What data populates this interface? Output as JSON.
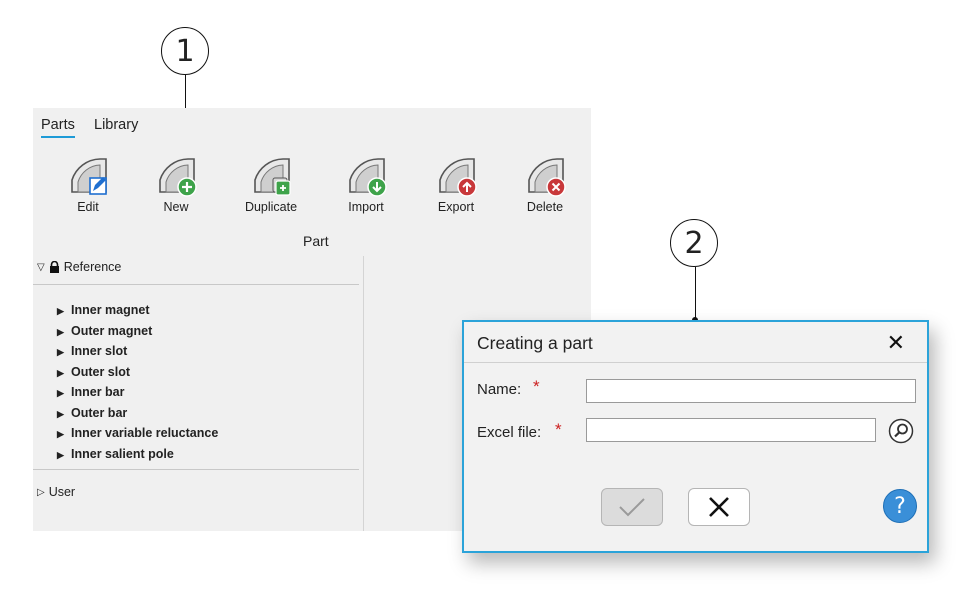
{
  "callouts": [
    "1",
    "2"
  ],
  "tabs": [
    {
      "label": "Parts",
      "active": true
    },
    {
      "label": "Library",
      "active": false
    }
  ],
  "toolbar": {
    "group_title": "Part",
    "buttons": [
      {
        "label": "Edit",
        "badge": "pencil-icon",
        "badge_color": "#1f6fd0"
      },
      {
        "label": "New",
        "badge": "plus-icon",
        "badge_color": "#3ea34a"
      },
      {
        "label": "Duplicate",
        "badge": "copy-icon",
        "badge_color": "#3ea34a"
      },
      {
        "label": "Import",
        "badge": "arrow-down-icon",
        "badge_color": "#3ea34a"
      },
      {
        "label": "Export",
        "badge": "arrow-up-icon",
        "badge_color": "#c8383a"
      },
      {
        "label": "Delete",
        "badge": "x-icon",
        "badge_color": "#c8383a"
      }
    ]
  },
  "tree": {
    "reference": {
      "label": "Reference",
      "items": [
        "Inner magnet",
        "Outer magnet",
        "Inner slot",
        "Outer slot",
        "Inner bar",
        "Outer bar",
        "Inner variable reluctance",
        "Inner salient pole"
      ]
    },
    "user": {
      "label": "User"
    }
  },
  "dialog": {
    "title": "Creating a part",
    "name_label": "Name:",
    "excel_label": "Excel file:",
    "required_mark": "*",
    "name_value": "",
    "excel_value": "",
    "help_glyph": "?"
  },
  "colors": {
    "accent": "#2ba3d9",
    "required": "#cc2020",
    "help": "#3a8fd8"
  }
}
